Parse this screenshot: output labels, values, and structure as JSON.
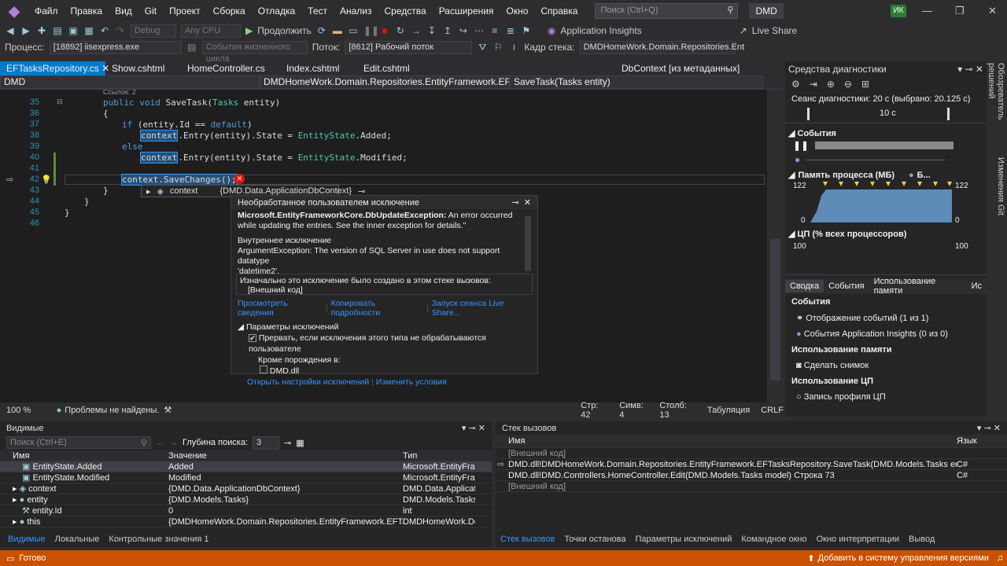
{
  "menu": {
    "items": [
      "Файл",
      "Правка",
      "Вид",
      "Git",
      "Проект",
      "Сборка",
      "Отладка",
      "Тест",
      "Анализ",
      "Средства",
      "Расширения",
      "Окно",
      "Справка"
    ],
    "search_placeholder": "Поиск (Ctrl+Q)",
    "solution": "DMD",
    "avatar": "ИК"
  },
  "toolbar": {
    "config": "Debug",
    "platform": "Any CPU",
    "continue_label": "Продолжить",
    "app_insights": "Application Insights",
    "live_share": "Live Share"
  },
  "toolbar2": {
    "process_label": "Процесс:",
    "process_value": "[18892] iisexpress.exe",
    "lifecycle_label": "События жизненного цикла",
    "thread_label": "Поток:",
    "thread_value": "[8612] Рабочий поток",
    "frame_label": "Кадр стека:",
    "frame_value": "DMDHomeWork.Domain.Repositories.Ent"
  },
  "tabs": [
    {
      "label": "EFTasksRepository.cs",
      "active": true
    },
    {
      "label": "Show.cshtml"
    },
    {
      "label": "HomeController.cs"
    },
    {
      "label": "Index.cshtml"
    },
    {
      "label": "Edit.cshtml"
    },
    {
      "label": "DbContext [из метаданных]"
    }
  ],
  "nav": {
    "project": "DMD",
    "type": "DMDHomeWork.Domain.Repositories.EntityFramework.EFTasksRep",
    "member": "SaveTask(Tasks entity)"
  },
  "code": {
    "refs": "Ссылок: 2",
    "line_numbers": [
      "35",
      "36",
      "37",
      "38",
      "39",
      "40",
      "41",
      "42",
      "43",
      "44",
      "45",
      "46"
    ]
  },
  "datatip": {
    "name": "context",
    "value": "{DMD.Data.ApplicationDbContext}"
  },
  "exception": {
    "title": "Необработанное пользователем исключение",
    "type": "Microsoft.EntityFrameworkCore.DbUpdateException:",
    "message_a": "An error occurred",
    "message_b": "while updating the entries. See the inner exception for details.\"",
    "inner_label": "Внутреннее исключение",
    "inner_a": "ArgumentException: The version of SQL Server in use does not support datatype",
    "inner_b": "'datetime2'.",
    "stack_label": "Изначально это исключение было создано в этом стеке вызовов:",
    "stack_value": "[Внешний код]",
    "link_details": "Просмотреть сведения",
    "link_copy": "Копировать подробности",
    "link_liveshare": "Запуск сеанса Live Share...",
    "settings_label": "Параметры исключений",
    "break_label": "Прервать, если исключения этого типа не обрабатываются пользователе",
    "except_label": "Кроме порождения в:",
    "dll": "DMD.dll",
    "open_settings": "Открыть настройки исключений",
    "change_conditions": "Изменить условия"
  },
  "edstatus": {
    "zoom": "100 %",
    "problems": "Проблемы не найдены.",
    "line": "Стр: 42",
    "col": "Симв: 4",
    "pos": "Столб: 13",
    "tabs": "Табуляция",
    "eol": "CRLF"
  },
  "diag": {
    "title": "Средства диагностики",
    "session": "Сеанс диагностики: 20 с (выбрано: 20.125 с)",
    "ruler": "10 с",
    "events": "События",
    "memory": "Память процесса (МБ)",
    "memory_legend": "Б...",
    "mem_max": "122",
    "mem_min": "0",
    "cpu": "ЦП (% всех процессоров)",
    "cpu_max": "100",
    "tabs": [
      "Сводка",
      "События",
      "Использование памяти",
      "Ис"
    ],
    "events_head": "События",
    "event_display": "Отображение событий (1 из 1)",
    "insights_events": "События Application Insights (0 из 0)",
    "memory_head": "Использование памяти",
    "snapshot": "Сделать снимок",
    "cpu_head": "Использование ЦП",
    "cpu_record": "Запись профиля ЦП"
  },
  "sidebar": [
    "Обозреватель решений",
    "Изменения Git"
  ],
  "locals": {
    "title": "Видимые",
    "search_placeholder": "Поиск (Ctrl+E)",
    "depth_label": "Глубина поиска:",
    "depth_value": "3",
    "headers": [
      "Имя",
      "Значение",
      "Тип"
    ],
    "rows": [
      {
        "name": "EntityState.Added",
        "value": "Added",
        "type": "Microsoft.EntityFra..."
      },
      {
        "name": "EntityState.Modified",
        "value": "Modified",
        "type": "Microsoft.EntityFra..."
      },
      {
        "name": "context",
        "value": "{DMD.Data.ApplicationDbContext}",
        "type": "DMD.Data.Applicati..."
      },
      {
        "name": "entity",
        "value": "{DMD.Models.Tasks}",
        "type": "DMD.Models.Tasks"
      },
      {
        "name": "entity.Id",
        "value": "0",
        "type": "int"
      },
      {
        "name": "this",
        "value": "{DMDHomeWork.Domain.Repositories.EntityFramework.EFTasksR...",
        "type": "DMDHomeWork.Do..."
      }
    ],
    "tabs": [
      "Видимые",
      "Локальные",
      "Контрольные значения 1"
    ]
  },
  "callstack": {
    "title": "Стек вызовов",
    "headers": [
      "Имя",
      "Язык"
    ],
    "rows": [
      {
        "name": "[Внешний код]",
        "lang": ""
      },
      {
        "name": "DMD.dll!DMDHomeWork.Domain.Repositories.EntityFramework.EFTasksRepository.SaveTask(DMD.Models.Tasks entity) Строка ...",
        "lang": "C#"
      },
      {
        "name": "DMD.dll!DMD.Controllers.HomeController.Edit(DMD.Models.Tasks model) Строка 73",
        "lang": "C#"
      },
      {
        "name": "[Внешний код]",
        "lang": ""
      }
    ],
    "tabs": [
      "Стек вызовов",
      "Точки останова",
      "Параметры исключений",
      "Командное окно",
      "Окно интерпретации",
      "Вывод"
    ]
  },
  "status": {
    "ready": "Готово",
    "vcs": "Добавить в систему управления версиями"
  }
}
